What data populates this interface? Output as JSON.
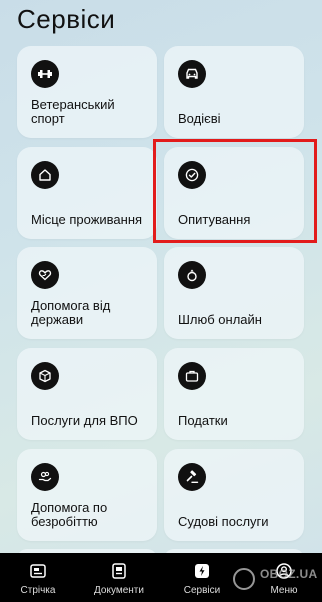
{
  "header": {
    "title": "Сервіси"
  },
  "cards": [
    {
      "label": "Ветеранський спорт",
      "icon": "dumbbell-icon"
    },
    {
      "label": "Водієві",
      "icon": "car-icon"
    },
    {
      "label": "Місце проживання",
      "icon": "house-icon"
    },
    {
      "label": "Опитування",
      "icon": "check-badge-icon"
    },
    {
      "label": "Допомога від держави",
      "icon": "hand-heart-icon"
    },
    {
      "label": "Шлюб онлайн",
      "icon": "ring-icon"
    },
    {
      "label": "Послуги для ВПО",
      "icon": "box-icon"
    },
    {
      "label": "Податки",
      "icon": "briefcase-icon"
    },
    {
      "label": "Допомога по безробіттю",
      "icon": "hand-coins-icon"
    },
    {
      "label": "Судові послуги",
      "icon": "gavel-icon"
    }
  ],
  "tabbar": {
    "items": [
      {
        "label": "Стрічка",
        "icon": "feed-icon",
        "active": false
      },
      {
        "label": "Документи",
        "icon": "documents-icon",
        "active": false
      },
      {
        "label": "Сервіси",
        "icon": "services-icon",
        "active": true
      },
      {
        "label": "Меню",
        "icon": "menu-icon",
        "active": false
      }
    ]
  },
  "watermark": {
    "text": "OBOZ.UA"
  },
  "colors": {
    "highlight": "#e21b1b",
    "tabbar": "#000000",
    "icon_bg": "#111111"
  }
}
